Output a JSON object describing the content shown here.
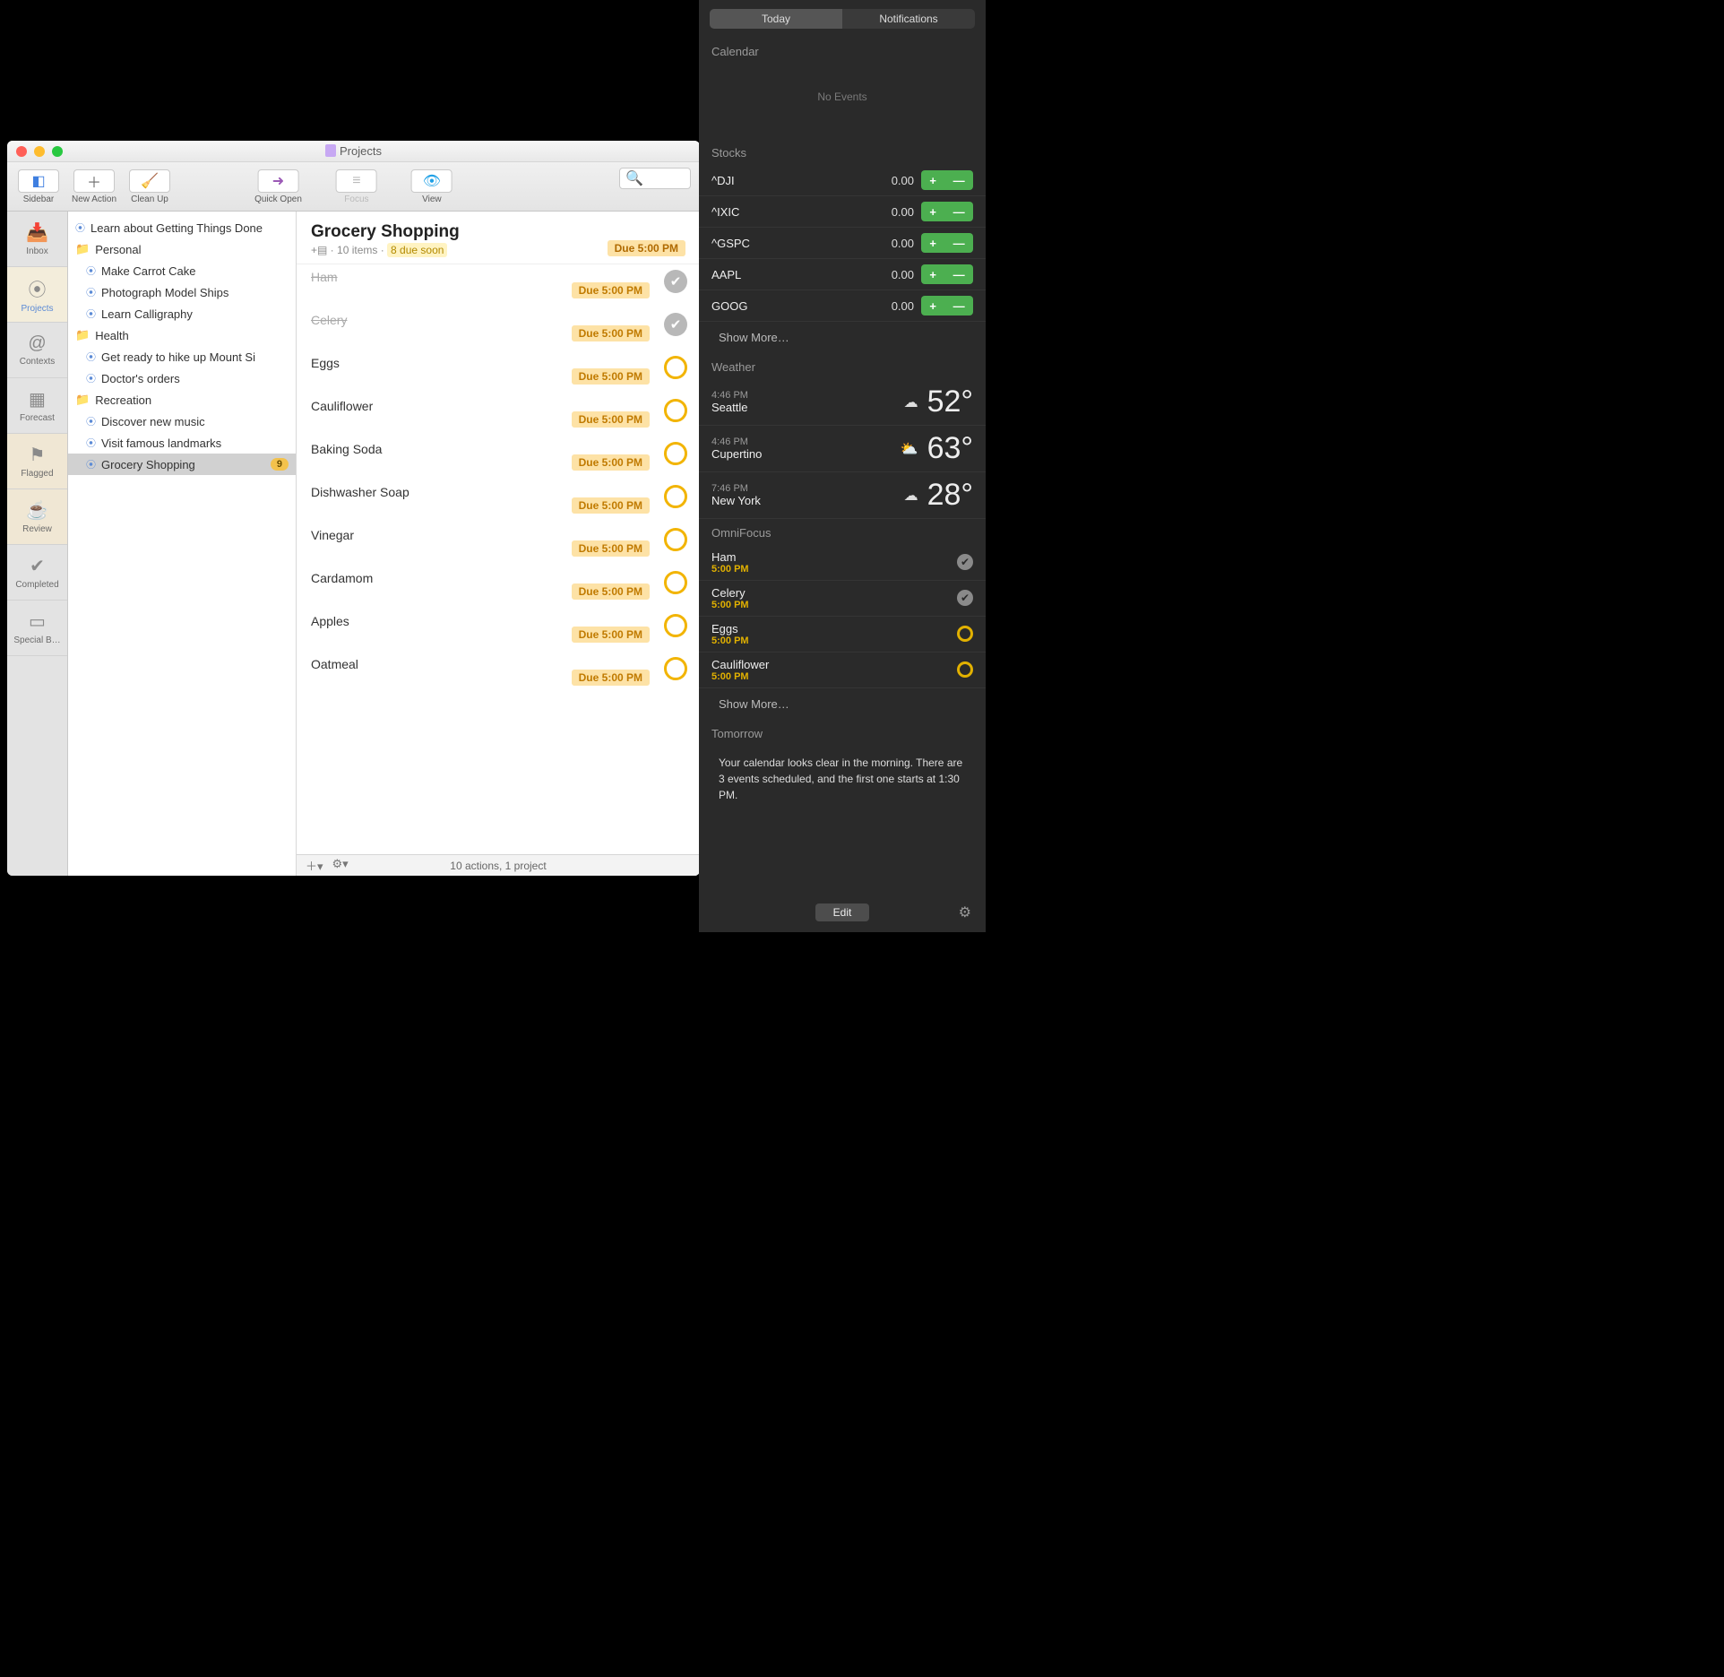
{
  "window": {
    "title": "Projects",
    "toolbar": {
      "sidebar": "Sidebar",
      "new_action": "New Action",
      "clean_up": "Clean Up",
      "quick_open": "Quick Open",
      "focus": "Focus",
      "view": "View"
    },
    "sidebar_tabs": [
      {
        "label": "Inbox",
        "icon": "inbox"
      },
      {
        "label": "Projects",
        "icon": "projects",
        "active": true
      },
      {
        "label": "Contexts",
        "icon": "contexts"
      },
      {
        "label": "Forecast",
        "icon": "forecast"
      },
      {
        "label": "Flagged",
        "icon": "flagged"
      },
      {
        "label": "Review",
        "icon": "review"
      },
      {
        "label": "Completed",
        "icon": "completed"
      },
      {
        "label": "Special B…",
        "icon": "special"
      }
    ],
    "tree": [
      {
        "type": "project",
        "label": "Learn about Getting Things Done",
        "indent": 0
      },
      {
        "type": "folder",
        "label": "Personal",
        "indent": 0
      },
      {
        "type": "project",
        "label": "Make Carrot Cake",
        "indent": 1
      },
      {
        "type": "project",
        "label": "Photograph Model Ships",
        "indent": 1
      },
      {
        "type": "project",
        "label": "Learn Calligraphy",
        "indent": 1
      },
      {
        "type": "folder",
        "label": "Health",
        "indent": 0
      },
      {
        "type": "project",
        "label": "Get ready to hike up Mount Si",
        "indent": 1
      },
      {
        "type": "project",
        "label": "Doctor's orders",
        "indent": 1
      },
      {
        "type": "folder",
        "label": "Recreation",
        "indent": 0
      },
      {
        "type": "project",
        "label": "Discover new music",
        "indent": 1
      },
      {
        "type": "project",
        "label": "Visit famous landmarks",
        "indent": 1
      },
      {
        "type": "project",
        "label": "Grocery Shopping",
        "indent": 1,
        "selected": true,
        "badge": "9"
      }
    ],
    "project": {
      "title": "Grocery Shopping",
      "items_count": "10 items",
      "due_soon_badge": "8 due soon",
      "due_label": "Due 5:00 PM",
      "tasks": [
        {
          "name": "Ham",
          "due": "Due 5:00 PM",
          "completed": true
        },
        {
          "name": "Celery",
          "due": "Due 5:00 PM",
          "completed": true
        },
        {
          "name": "Eggs",
          "due": "Due 5:00 PM",
          "completed": false
        },
        {
          "name": "Cauliflower",
          "due": "Due 5:00 PM",
          "completed": false
        },
        {
          "name": "Baking Soda",
          "due": "Due 5:00 PM",
          "completed": false
        },
        {
          "name": "Dishwasher Soap",
          "due": "Due 5:00 PM",
          "completed": false
        },
        {
          "name": "Vinegar",
          "due": "Due 5:00 PM",
          "completed": false
        },
        {
          "name": "Cardamom",
          "due": "Due 5:00 PM",
          "completed": false
        },
        {
          "name": "Apples",
          "due": "Due 5:00 PM",
          "completed": false
        },
        {
          "name": "Oatmeal",
          "due": "Due 5:00 PM",
          "completed": false
        }
      ]
    },
    "statusbar": "10 actions, 1 project"
  },
  "nc": {
    "tabs": {
      "today": "Today",
      "notifications": "Notifications"
    },
    "calendar": {
      "title": "Calendar",
      "empty": "No Events"
    },
    "stocks": {
      "title": "Stocks",
      "rows": [
        {
          "sym": "^DJI",
          "val": "0.00"
        },
        {
          "sym": "^IXIC",
          "val": "0.00"
        },
        {
          "sym": "^GSPC",
          "val": "0.00"
        },
        {
          "sym": "AAPL",
          "val": "0.00"
        },
        {
          "sym": "GOOG",
          "val": "0.00"
        }
      ],
      "show_more": "Show More…"
    },
    "weather": {
      "title": "Weather",
      "rows": [
        {
          "time": "4:46 PM",
          "city": "Seattle",
          "icon": "cloud",
          "temp": "52°"
        },
        {
          "time": "4:46 PM",
          "city": "Cupertino",
          "icon": "partly",
          "temp": "63°"
        },
        {
          "time": "7:46 PM",
          "city": "New York",
          "icon": "cloud",
          "temp": "28°"
        }
      ]
    },
    "omnifocus": {
      "title": "OmniFocus",
      "items": [
        {
          "name": "Ham",
          "time": "5:00 PM",
          "done": true
        },
        {
          "name": "Celery",
          "time": "5:00 PM",
          "done": true
        },
        {
          "name": "Eggs",
          "time": "5:00 PM",
          "done": false
        },
        {
          "name": "Cauliflower",
          "time": "5:00 PM",
          "done": false
        }
      ],
      "show_more": "Show More…"
    },
    "tomorrow": {
      "title": "Tomorrow",
      "text": "Your calendar looks clear in the morning. There are 3 events scheduled, and the first one starts at 1:30 PM."
    },
    "edit": "Edit"
  }
}
